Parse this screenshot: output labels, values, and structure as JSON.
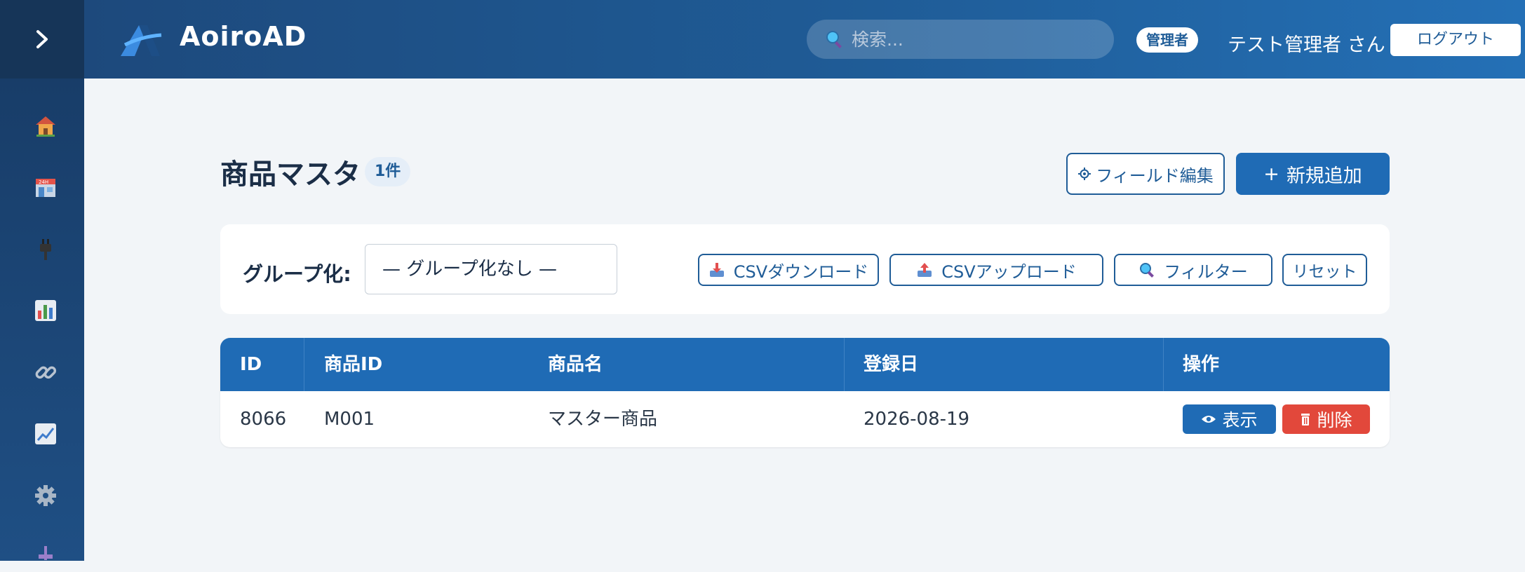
{
  "app": {
    "name": "AoiroAD",
    "brand_color": "#1f6bb5",
    "danger_color": "#e2483b",
    "header_gradient": [
      "#1d497c",
      "#2470b6"
    ]
  },
  "sidebar": {
    "toggle_icon": "chevron-right-icon",
    "items": [
      {
        "icon": "home-icon"
      },
      {
        "icon": "store-24h-icon"
      },
      {
        "icon": "plug-icon"
      },
      {
        "icon": "bar-chart-icon"
      },
      {
        "icon": "link-icon"
      },
      {
        "icon": "trend-chart-icon"
      },
      {
        "icon": "gear-icon"
      },
      {
        "icon": "pin-icon"
      }
    ]
  },
  "header": {
    "search_placeholder": "検索...",
    "role_badge": "管理者",
    "user_name": "テスト管理者 さん",
    "logout_label": "ログアウト"
  },
  "page": {
    "title": "商品マスタ",
    "count_badge": "1件",
    "field_edit_label": "フィールド編集",
    "add_new_label": "新規追加"
  },
  "toolbar": {
    "group_label": "グループ化:",
    "group_value": "— グループ化なし —",
    "csv_download_label": "CSVダウンロード",
    "csv_upload_label": "CSVアップロード",
    "filter_label": "フィルター",
    "reset_label": "リセット"
  },
  "table": {
    "columns": [
      "ID",
      "商品ID",
      "商品名",
      "登録日",
      "操作"
    ],
    "rows": [
      {
        "id": "8066",
        "product_id": "M001",
        "product_name": "マスター商品",
        "registered": "2026-08-19"
      }
    ],
    "view_label": "表示",
    "delete_label": "削除"
  }
}
